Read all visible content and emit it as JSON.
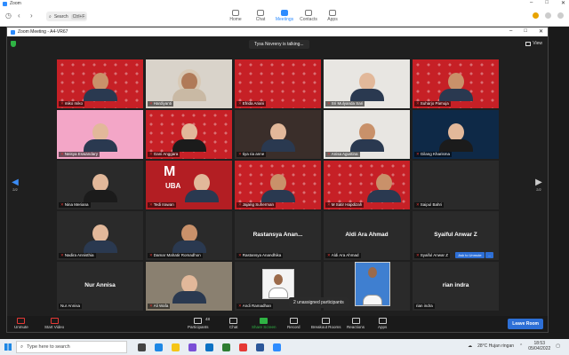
{
  "app": {
    "title": "Zoom",
    "search_label": "Search",
    "search_shortcut": "Ctrl+F",
    "tabs": [
      {
        "label": "Home",
        "icon": "home-icon"
      },
      {
        "label": "Chat",
        "icon": "chat-icon"
      },
      {
        "label": "Meetings",
        "icon": "meetings-icon",
        "active": true
      },
      {
        "label": "Contacts",
        "icon": "contacts-icon"
      },
      {
        "label": "Apps",
        "icon": "apps-icon"
      }
    ]
  },
  "meeting": {
    "title": "Zoom Meeting - A4-VR67",
    "talking": "Tysa Novreny is talking...",
    "view_label": "View",
    "pager_left": "2/2",
    "pager_right": "2/2",
    "unassigned": "2 unassigned participants",
    "ask_unmute": "Ask to Unmute",
    "ask_more": "...",
    "participants": [
      {
        "name": "miko miko"
      },
      {
        "name": "Hardiyanti"
      },
      {
        "name": "Efrida Ariani"
      },
      {
        "name": "Sri Mulyanda Sari"
      },
      {
        "name": "Suharjo Pamuja"
      },
      {
        "name": "Neisya Eswandary"
      },
      {
        "name": "Gani Anggara"
      },
      {
        "name": "tiya ria anne"
      },
      {
        "name": "Anisa Agustina"
      },
      {
        "name": "Gilang Kharisma"
      },
      {
        "name": "Nina Meriana"
      },
      {
        "name": "Tedi Irawan"
      },
      {
        "name": "Jajang Suherman"
      },
      {
        "name": "M Satir Hapdizah"
      },
      {
        "name": "Saipul Bahri"
      },
      {
        "name": "Nadira Annisthia"
      },
      {
        "name": "Damar Mahatir Romadhon"
      },
      {
        "name": "Rastansya Anandhika",
        "center": "Rastansya  Anan..."
      },
      {
        "name": "Aldi Ara Ahmad",
        "center": "Aldi Ara Ahmad"
      },
      {
        "name": "Syaiful Anwar Z",
        "center": "Syaiful Anwar Z"
      },
      {
        "name": "Nur Annisa",
        "center": "Nur Annisa"
      },
      {
        "name": "Ali Wafa"
      },
      {
        "name": "Andi Ramadhan"
      },
      {
        "name": ""
      },
      {
        "name": "rian indra",
        "center": "rian indra"
      }
    ],
    "slide_big": "M",
    "slide_small": "UBA",
    "toolbar": {
      "unmute": "Unmute",
      "start_video": "Start Video",
      "participants": "Participants",
      "participants_count": "48",
      "chat": "Chat",
      "share_screen": "Share Screen",
      "record": "Record",
      "breakout": "Breakout Rooms",
      "reactions": "Reactions",
      "apps": "Apps",
      "leave": "Leave Room"
    }
  },
  "taskbar": {
    "search_placeholder": "Type here to search",
    "weather": "28°C  Hujan ringan",
    "time": "18:53",
    "date": "05/04/2022"
  },
  "colors": {
    "accent": "#2d8cff",
    "red_bg": "#c62026",
    "leave": "#2d6fd6",
    "share": "#2fb344"
  }
}
